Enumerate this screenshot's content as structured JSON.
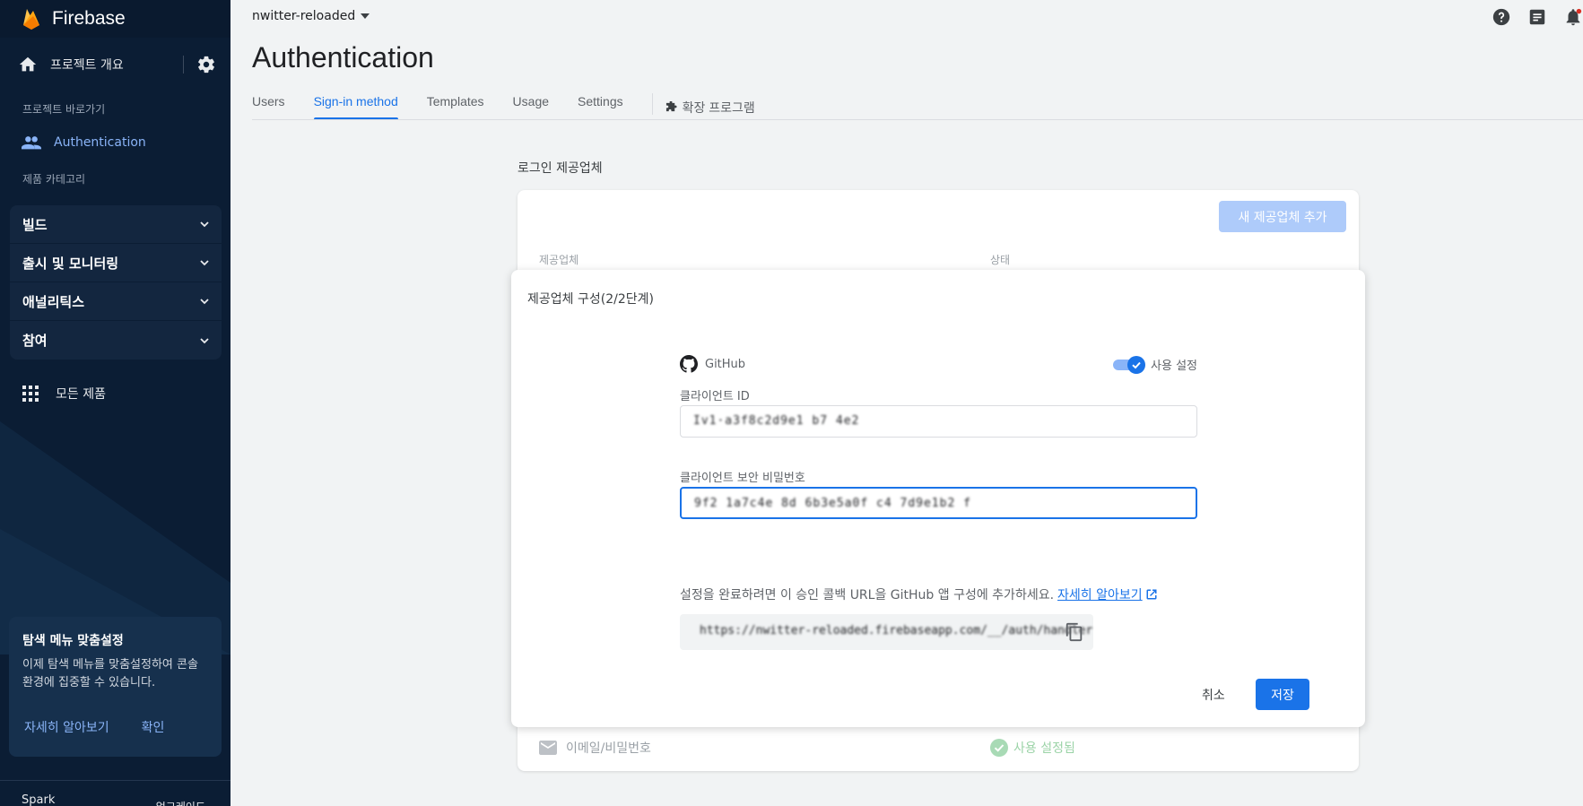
{
  "sidebar": {
    "brand": "Firebase",
    "overview": "프로젝트 개요",
    "shortcuts_label": "프로젝트 바로가기",
    "auth_item": "Authentication",
    "categories_label": "제품 카테고리",
    "groups": [
      {
        "label": "빌드"
      },
      {
        "label": "출시 및 모니터링"
      },
      {
        "label": "애널리틱스"
      },
      {
        "label": "참여"
      }
    ],
    "all_products": "모든 제품",
    "card": {
      "title": "탐색 메뉴 맞춤설정",
      "desc_line1": "이제 탐색 메뉴를 맞춤설정하여 콘솔",
      "desc_line2": "환경에 집중할 수 있습니다.",
      "learn_more": "자세히 알아보기",
      "confirm": "확인"
    },
    "footer": {
      "plan": "Spark",
      "upgrade": "업그레이드"
    }
  },
  "header": {
    "project_name": "nwitter-reloaded",
    "page_title": "Authentication",
    "tabs": [
      {
        "label": "Users"
      },
      {
        "label": "Sign-in method"
      },
      {
        "label": "Templates"
      },
      {
        "label": "Usage"
      },
      {
        "label": "Settings"
      }
    ],
    "ext_tab": "확장 프로그램"
  },
  "providers": {
    "section_title": "로그인 제공업체",
    "add_button": "새 제공업체 추가",
    "col_provider": "제공업체",
    "col_status": "상태",
    "email_row": "이메일/비밀번호",
    "email_status": "사용 설정됨"
  },
  "modal": {
    "title": "제공업체 구성(2/2단계)",
    "provider_name": "GitHub",
    "enable_label": "사용 설정",
    "client_id_label": "클라이언트 ID",
    "client_id_value": "Iv1·a3f8c2d9e1 b7 4e2",
    "secret_label": "클라이언트 보안 비밀번호",
    "secret_value": "9f2 1a7c4e 8d 6b3e5a0f   c4  7d9e1b2  f",
    "hint_text": "설정을 완료하려면 이 승인 콜백 URL을 GitHub 앱 구성에 추가하세요.",
    "hint_link": "자세히 알아보기",
    "callback_url": "https://nwitter-reloaded.firebaseapp.com/__/auth/handler",
    "cancel": "취소",
    "save": "저장"
  },
  "colors": {
    "accent": "#1a73e8",
    "sidebar_bg": "#0b1d34"
  }
}
